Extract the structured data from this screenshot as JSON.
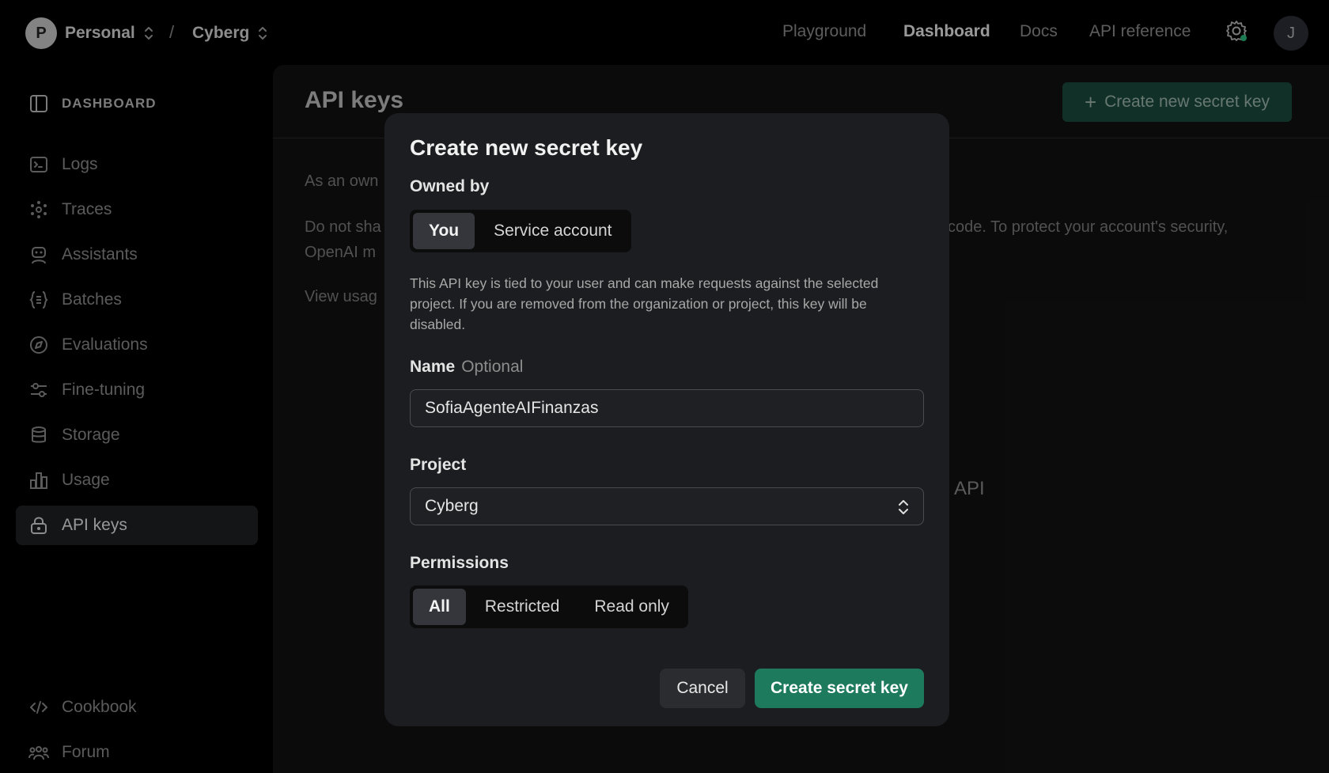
{
  "breadcrumb": {
    "org_initial": "P",
    "org_name": "Personal",
    "separator": "/",
    "project_name": "Cyberg"
  },
  "topnav": {
    "items": [
      "Playground",
      "Dashboard",
      "Docs",
      "API reference"
    ],
    "active": "Dashboard",
    "user_initial": "J"
  },
  "sidebar": {
    "header": "DASHBOARD",
    "items": [
      {
        "label": "Logs",
        "icon": "terminal-icon"
      },
      {
        "label": "Traces",
        "icon": "traces-icon"
      },
      {
        "label": "Assistants",
        "icon": "robot-icon"
      },
      {
        "label": "Batches",
        "icon": "batches-icon"
      },
      {
        "label": "Evaluations",
        "icon": "compass-icon"
      },
      {
        "label": "Fine-tuning",
        "icon": "sliders-icon"
      },
      {
        "label": "Storage",
        "icon": "database-icon"
      },
      {
        "label": "Usage",
        "icon": "bar-chart-icon"
      },
      {
        "label": "API keys",
        "icon": "lock-icon"
      }
    ],
    "active": "API keys",
    "footer_items": [
      {
        "label": "Cookbook",
        "icon": "code-icon"
      },
      {
        "label": "Forum",
        "icon": "people-icon"
      }
    ]
  },
  "main": {
    "title": "API keys",
    "create_button": "Create new secret key",
    "text_1": "As an own",
    "text_2a": "Do not sha",
    "text_2b": "code. To protect your account's security,",
    "text_3": "OpenAI m",
    "text_4": "View usag",
    "text_5": "I API"
  },
  "modal": {
    "title": "Create new secret key",
    "owned_by_label": "Owned by",
    "owned_by_options": [
      "You",
      "Service account"
    ],
    "owned_by_selected": "You",
    "description": "This API key is tied to your user and can make requests against the selected project. If you are removed from the organization or project, this key will be disabled.",
    "name_label": "Name",
    "name_optional": "Optional",
    "name_value": "SofiaAgenteAIFinanzas",
    "project_label": "Project",
    "project_value": "Cyberg",
    "permissions_label": "Permissions",
    "permissions_options": [
      "All",
      "Restricted",
      "Read only"
    ],
    "permissions_selected": "All",
    "cancel_label": "Cancel",
    "submit_label": "Create secret key"
  },
  "colors": {
    "accent_green": "#1d7a5c",
    "background": "#000000",
    "modal_bg": "#1c1d20"
  }
}
